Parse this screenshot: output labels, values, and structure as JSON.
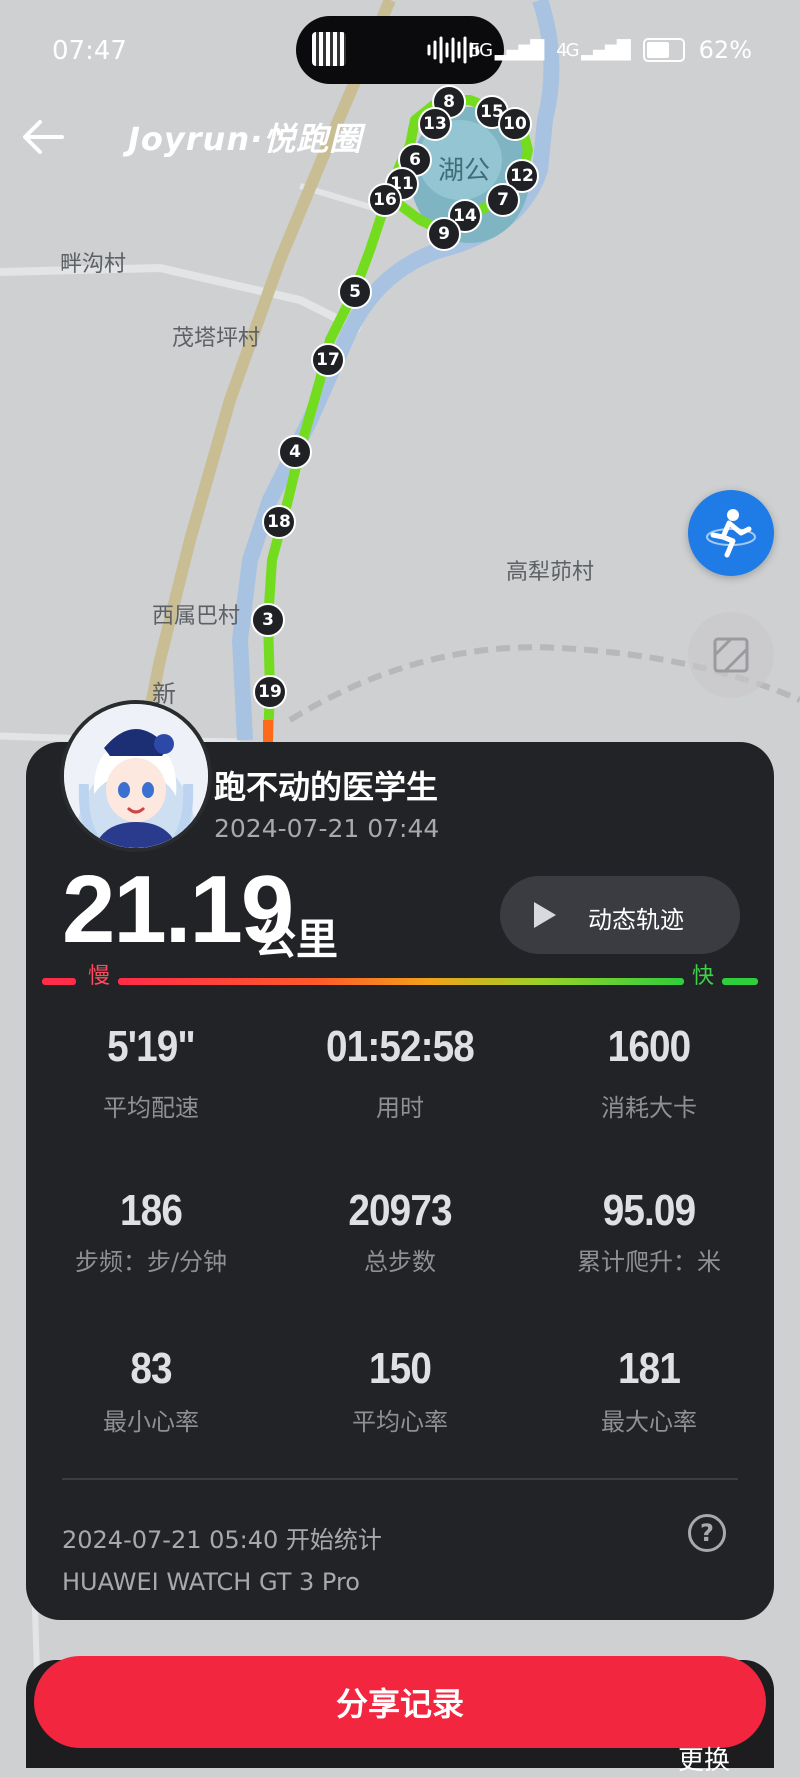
{
  "status_bar": {
    "time": "07:47",
    "signal_1": "5G",
    "signal_2": "4G",
    "battery": "62%"
  },
  "header": {
    "brand": "Joyrun·悦跑圈"
  },
  "map": {
    "labels": [
      "畔沟村",
      "茂塔坪村",
      "高犁茆村",
      "西属巴村",
      "新",
      "湖公"
    ],
    "km_markers": [
      "8",
      "15",
      "10",
      "13",
      "6",
      "12",
      "11",
      "7",
      "16",
      "14",
      "9",
      "5",
      "17",
      "4",
      "18",
      "3",
      "19"
    ]
  },
  "runner": {
    "name": "跑不动的医学生",
    "date": "2024-07-21 07:44"
  },
  "summary": {
    "distance": "21.19",
    "unit": "公里",
    "replay_label": "动态轨迹"
  },
  "pace_legend": {
    "slow": "慢",
    "fast": "快"
  },
  "stats": [
    {
      "value": "5'19\"",
      "label": "平均配速"
    },
    {
      "value": "01:52:58",
      "label": "用时"
    },
    {
      "value": "1600",
      "label": "消耗大卡"
    },
    {
      "value": "186",
      "label": "步频：步/分钟"
    },
    {
      "value": "20973",
      "label": "总步数"
    },
    {
      "value": "95.09",
      "label": "累计爬升：米"
    },
    {
      "value": "83",
      "label": "最小心率"
    },
    {
      "value": "150",
      "label": "平均心率"
    },
    {
      "value": "181",
      "label": "最大心率"
    }
  ],
  "footer": {
    "start_time": "2024-07-21 05:40 开始统计",
    "device": "HUAWEI WATCH GT 3 Pro",
    "help": "?"
  },
  "share_button": "分享记录",
  "bottom_hint": "更换",
  "colors": {
    "accent": "#f2263f",
    "route": "#7be01f",
    "card": "#222326",
    "fab": "#1f7be6"
  }
}
